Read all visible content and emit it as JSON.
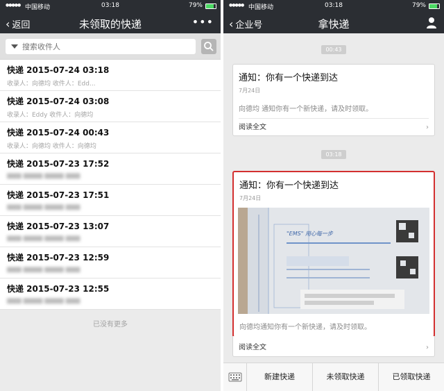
{
  "left": {
    "status": {
      "carrier": "中国移动",
      "time": "03:18",
      "battery": "79%"
    },
    "nav": {
      "back_label": "返回",
      "title": "未领取的快递"
    },
    "search": {
      "placeholder": "搜索收件人"
    },
    "items": [
      {
        "title": "快递 2015-07-24 03:18",
        "sub": "收录人：向德均      收件人：Edd..."
      },
      {
        "title": "快递 2015-07-24 03:08",
        "sub": "收录人：Eddy      收件人：向德均"
      },
      {
        "title": "快递 2015-07-24 00:43",
        "sub": "收录人：向德均      收件人：向德均"
      },
      {
        "title": "快递 2015-07-23 17:52",
        "sub": ""
      },
      {
        "title": "快递 2015-07-23 17:51",
        "sub": ""
      },
      {
        "title": "快递 2015-07-23 13:07",
        "sub": ""
      },
      {
        "title": "快递 2015-07-23 12:59",
        "sub": ""
      },
      {
        "title": "快递 2015-07-23 12:55",
        "sub": ""
      }
    ],
    "no_more": "已没有更多"
  },
  "right": {
    "status": {
      "carrier": "中国移动",
      "time": "03:18",
      "battery": "79%"
    },
    "nav": {
      "back_label": "企业号",
      "title": "拿快递"
    },
    "messages": [
      {
        "time": "00:43",
        "title": "通知：你有一个快递到达",
        "date": "7月24日",
        "body": "向德均 通知你有一个新快递，请及时领取。",
        "read_more": "阅读全文"
      },
      {
        "time": "03:18",
        "title": "通知：你有一个快递到达",
        "date": "7月24日",
        "body": "向德均通知你有一个新快递，请及时领取。",
        "read_more": "阅读全文"
      }
    ],
    "tabs": [
      "新建快递",
      "未领取快递",
      "已领取快递"
    ]
  },
  "colors": {
    "nav_bg": "#2b2e33",
    "highlight": "#d32f2f",
    "battery": "#4cd964"
  }
}
